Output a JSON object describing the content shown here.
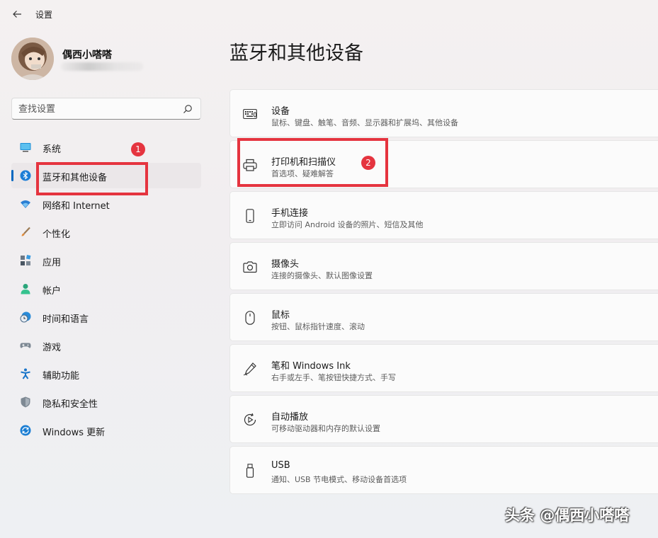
{
  "window": {
    "title": "设置",
    "back_icon": "back-arrow-icon"
  },
  "profile": {
    "name": "偶西小嗒嗒"
  },
  "search": {
    "placeholder": "查找设置",
    "icon": "search-icon"
  },
  "nav": {
    "items": [
      {
        "label": "系统",
        "icon": "system-icon"
      },
      {
        "label": "蓝牙和其他设备",
        "icon": "bluetooth-icon",
        "selected": true
      },
      {
        "label": "网络和 Internet",
        "icon": "wifi-icon"
      },
      {
        "label": "个性化",
        "icon": "brush-icon"
      },
      {
        "label": "应用",
        "icon": "apps-icon"
      },
      {
        "label": "帐户",
        "icon": "account-icon"
      },
      {
        "label": "时间和语言",
        "icon": "clock-globe-icon"
      },
      {
        "label": "游戏",
        "icon": "gamepad-icon"
      },
      {
        "label": "辅助功能",
        "icon": "accessibility-icon"
      },
      {
        "label": "隐私和安全性",
        "icon": "shield-icon"
      },
      {
        "label": "Windows 更新",
        "icon": "update-icon"
      }
    ]
  },
  "main": {
    "title": "蓝牙和其他设备",
    "cards": [
      {
        "title": "设备",
        "subtitle": "鼠标、键盘、触笔、音频、显示器和扩展坞、其他设备",
        "icon": "devices-icon"
      },
      {
        "title": "打印机和扫描仪",
        "subtitle": "首选项、疑难解答",
        "icon": "printer-icon"
      },
      {
        "title": "手机连接",
        "subtitle": "立即访问 Android 设备的照片、短信及其他",
        "icon": "phone-icon"
      },
      {
        "title": "摄像头",
        "subtitle": "连接的摄像头、默认图像设置",
        "icon": "camera-icon"
      },
      {
        "title": "鼠标",
        "subtitle": "按钮、鼠标指针速度、滚动",
        "icon": "mouse-icon"
      },
      {
        "title": "笔和 Windows Ink",
        "subtitle": "右手或左手、笔按钮快捷方式、手写",
        "icon": "pen-icon"
      },
      {
        "title": "自动播放",
        "subtitle": "可移动驱动器和内存的默认设置",
        "icon": "autoplay-icon"
      },
      {
        "title": "USB",
        "subtitle": "通知、USB 节电模式、移动设备首选项",
        "icon": "usb-icon"
      }
    ]
  },
  "annotations": {
    "badge1": "1",
    "badge2": "2",
    "color": "#e5343f"
  },
  "accent": "#0067c0",
  "watermark": "头条 @偶西小嗒嗒"
}
